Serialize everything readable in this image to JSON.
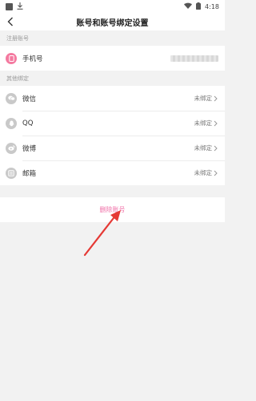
{
  "status_bar": {
    "time": "4:18"
  },
  "header": {
    "title": "账号和账号绑定设置"
  },
  "registered": {
    "section_label": "注册账号",
    "item": {
      "label": "手机号",
      "icon": "phone-icon",
      "color": "#f47aa0"
    }
  },
  "other": {
    "section_label": "其他绑定",
    "items": [
      {
        "label": "微信",
        "status": "未绑定",
        "icon": "wechat-icon"
      },
      {
        "label": "QQ",
        "status": "未绑定",
        "icon": "qq-icon"
      },
      {
        "label": "微博",
        "status": "未绑定",
        "icon": "weibo-icon"
      },
      {
        "label": "邮箱",
        "status": "未绑定",
        "icon": "mail-icon"
      }
    ]
  },
  "footer": {
    "delete_label": "删除账号"
  },
  "colors": {
    "accent": "#f070a8",
    "arrow": "#e53935",
    "icon_gray": "#c9c9c9"
  }
}
